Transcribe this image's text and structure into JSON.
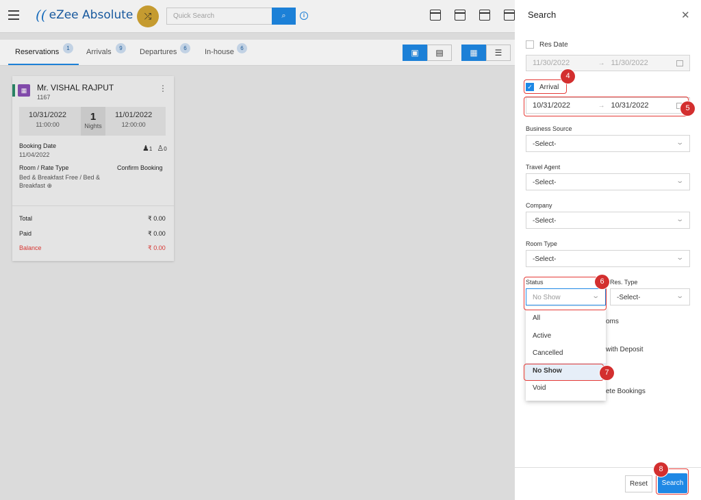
{
  "app": {
    "logo": "eZee Absolute",
    "logo_mark": "(("
  },
  "topbar": {
    "search_placeholder": "Quick Search"
  },
  "tabs": [
    {
      "label": "Reservations",
      "count": "1"
    },
    {
      "label": "Arrivals",
      "count": "9"
    },
    {
      "label": "Departures",
      "count": "6"
    },
    {
      "label": "In-house",
      "count": "6"
    }
  ],
  "card": {
    "guest_name": "Mr. VISHAL RAJPUT",
    "guest_id": "1167",
    "arrival_date": "10/31/2022",
    "arrival_time": "11:00:00",
    "nights_count": "1",
    "nights_label": "Nights",
    "departure_date": "11/01/2022",
    "departure_time": "12:00:00",
    "booking_date_label": "Booking Date",
    "booking_date": "11/04/2022",
    "adults": "1",
    "children": "0",
    "room_rate_label": "Room / Rate Type",
    "room_rate": "Bed & Breakfast Free / Bed & Breakfast",
    "status": "Confirm Booking",
    "total_label": "Total",
    "total": "₹ 0.00",
    "paid_label": "Paid",
    "paid": "₹ 0.00",
    "balance_label": "Balance",
    "balance": "₹ 0.00"
  },
  "search_panel": {
    "title": "Search",
    "res_date_label": "Res Date",
    "res_date_from": "11/30/2022",
    "res_date_to": "11/30/2022",
    "arrival_label": "Arrival",
    "arrival_from": "10/31/2022",
    "arrival_to": "10/31/2022",
    "business_source_label": "Business Source",
    "travel_agent_label": "Travel Agent",
    "company_label": "Company",
    "room_type_label": "Room Type",
    "status_label": "Status",
    "res_type_label": "Res. Type",
    "select_placeholder": "-Select-",
    "status_value": "No Show",
    "status_options": [
      "All",
      "Active",
      "Cancelled",
      "No Show",
      "Void"
    ],
    "partial_rooms": "oms",
    "partial_deposit": "with Deposit",
    "partial_bookings": "ete Bookings",
    "reset_label": "Reset",
    "search_label": "Search"
  },
  "annotations": [
    "4",
    "5",
    "6",
    "7",
    "8"
  ],
  "colors": {
    "accent": "#1e88e5",
    "highlight": "#e53935",
    "logo_gold": "#d2a533"
  }
}
